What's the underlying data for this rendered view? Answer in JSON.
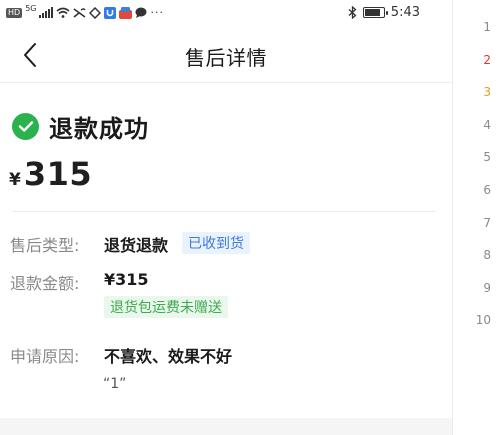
{
  "statusbar": {
    "hd": "HD",
    "net": "5G",
    "time": "5:43",
    "battery_level": 0.85,
    "icons": [
      "signal-icon",
      "wifi-icon",
      "muted-icon",
      "shield-app-icon",
      "u-app-icon",
      "store-app-icon",
      "chat-icon",
      "more-dots-icon",
      "bluetooth-icon",
      "battery-icon"
    ]
  },
  "header": {
    "title": "售后详情",
    "back_icon": "chevron-left-icon"
  },
  "status": {
    "text": "退款成功",
    "icon": "check-circle-icon",
    "color": "#2bb24c"
  },
  "amount": {
    "currency": "¥",
    "value": "315"
  },
  "details": {
    "type_label": "售后类型:",
    "type_value": "退货退款",
    "type_tag": "已收到货",
    "refund_label": "退款金额:",
    "refund_value": "¥315",
    "refund_tag": "退货包运费未赠送",
    "reason_label": "申请原因:",
    "reason_value": "不喜欢、效果不好",
    "reason_note": "“1”"
  },
  "ruler": [
    {
      "n": "1",
      "color": "#8a8a8a"
    },
    {
      "n": "2",
      "color": "#d9352b"
    },
    {
      "n": "3",
      "color": "#e89b1c"
    },
    {
      "n": "4",
      "color": "#8a8a8a"
    },
    {
      "n": "5",
      "color": "#8a8a8a"
    },
    {
      "n": "6",
      "color": "#8a8a8a"
    },
    {
      "n": "7",
      "color": "#8a8a8a"
    },
    {
      "n": "8",
      "color": "#8a8a8a"
    },
    {
      "n": "9",
      "color": "#8a8a8a"
    },
    {
      "n": "10",
      "color": "#8a8a8a"
    }
  ]
}
